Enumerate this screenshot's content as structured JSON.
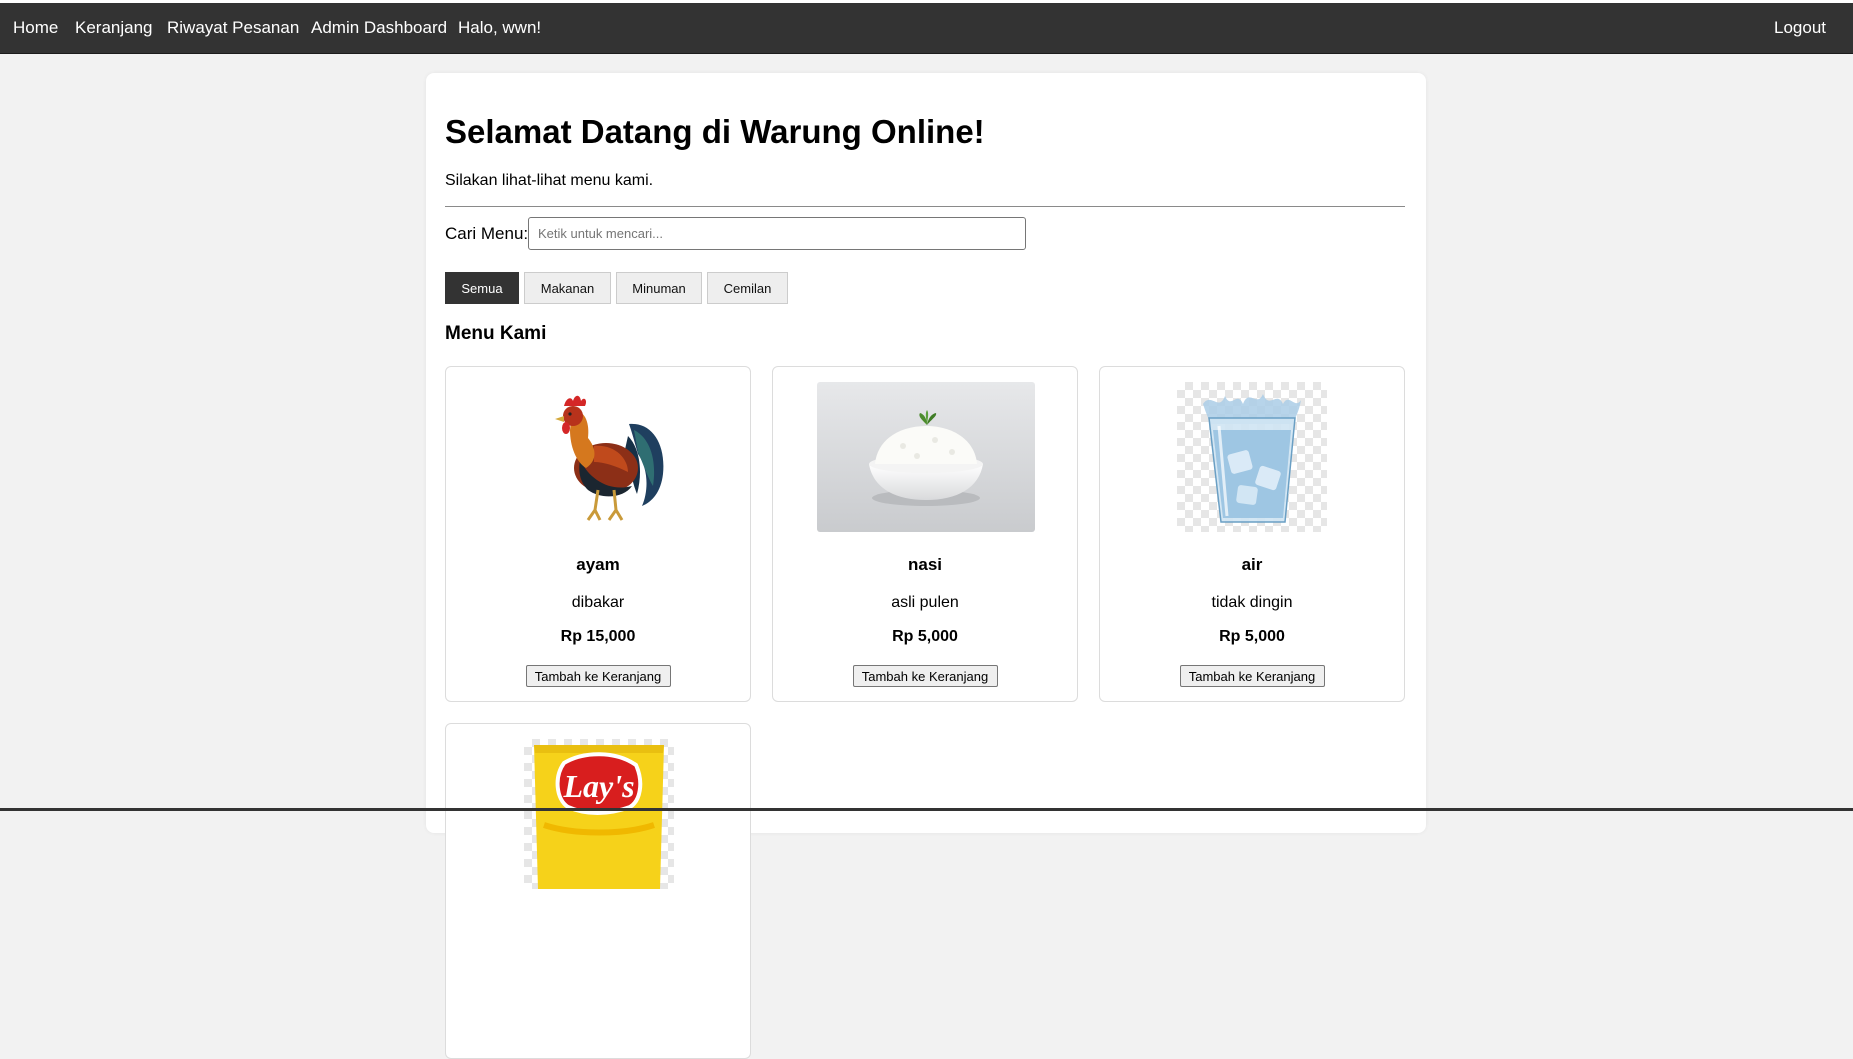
{
  "nav": {
    "home": "Home",
    "cart": "Keranjang",
    "orders": "Riwayat Pesanan",
    "admin": "Admin Dashboard",
    "greeting": "Halo, wwn!",
    "logout": "Logout"
  },
  "page": {
    "title": "Selamat Datang di Warung Online!",
    "subtitle": "Silakan lihat-lihat menu kami."
  },
  "search": {
    "label": "Cari Menu:",
    "placeholder": "Ketik untuk mencari...",
    "value": ""
  },
  "filters": {
    "all": "Semua",
    "food": "Makanan",
    "drink": "Minuman",
    "snack": "Cemilan",
    "active": "Semua"
  },
  "menu": {
    "title": "Menu Kami",
    "items": [
      {
        "name": "ayam",
        "desc": "dibakar",
        "price": "Rp 15,000",
        "button": "Tambah ke Keranjang",
        "image": "rooster-image"
      },
      {
        "name": "nasi",
        "desc": "asli pulen",
        "price": "Rp 5,000",
        "button": "Tambah ke Keranjang",
        "image": "rice-bowl-image"
      },
      {
        "name": "air",
        "desc": "tidak dingin",
        "price": "Rp 5,000",
        "button": "Tambah ke Keranjang",
        "image": "water-glass-image"
      },
      {
        "name": "",
        "desc": "",
        "price": "",
        "button": "",
        "image": "chips-bag-image",
        "logo_text": "Lay's"
      }
    ]
  },
  "colors": {
    "navbar": "#333333",
    "page_bg": "#f2f2f2",
    "active_filter": "#333333",
    "chips_yellow": "#f6d21a",
    "chips_red": "#d81e1e"
  }
}
